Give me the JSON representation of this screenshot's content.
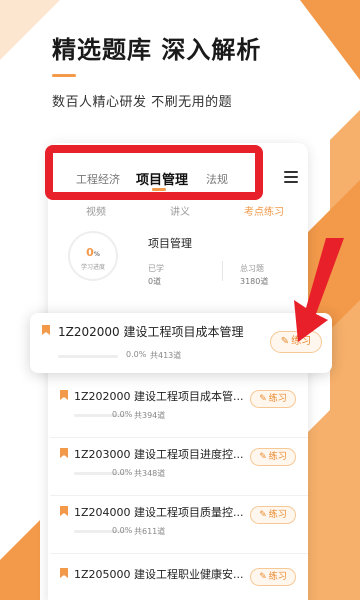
{
  "hero": {
    "title": "精选题库  深入解析",
    "subtitle": "数百人精心研发  不刷无用的题"
  },
  "colors": {
    "accent": "#f2994a",
    "highlight": "#e8202a"
  },
  "tabs": [
    {
      "label": "工程经济",
      "active": false
    },
    {
      "label": "项目管理",
      "active": true
    },
    {
      "label": "法规",
      "active": false
    }
  ],
  "subtabs": [
    {
      "label": "视频",
      "active": false
    },
    {
      "label": "讲义",
      "active": false
    },
    {
      "label": "考点练习",
      "active": true
    }
  ],
  "progress": {
    "value": "0",
    "unit": "%",
    "label": "学习进度",
    "subject": "项目管理",
    "learned_label": "已学",
    "learned_value": "0道",
    "total_label": "总习题",
    "total_value": "3180道"
  },
  "featured": {
    "title": "1Z202000 建设工程项目成本管理",
    "percent": "0.0%",
    "count": "共413道",
    "button": "练习"
  },
  "items": [
    {
      "title": "1Z202000 建设工程项目成本管...",
      "percent": "0.0%",
      "count": "共394道",
      "button": "练习"
    },
    {
      "title": "1Z203000 建设工程项目进度控...",
      "percent": "0.0%",
      "count": "共348道",
      "button": "练习"
    },
    {
      "title": "1Z204000 建设工程项目质量控...",
      "percent": "0.0%",
      "count": "共611道",
      "button": "练习"
    },
    {
      "title": "1Z205000 建设工程职业健康安...",
      "percent": "",
      "count": "",
      "button": "练习"
    }
  ],
  "icons": [
    "menu-icon",
    "bookmark-icon",
    "pencil-icon",
    "arrow-icon"
  ]
}
